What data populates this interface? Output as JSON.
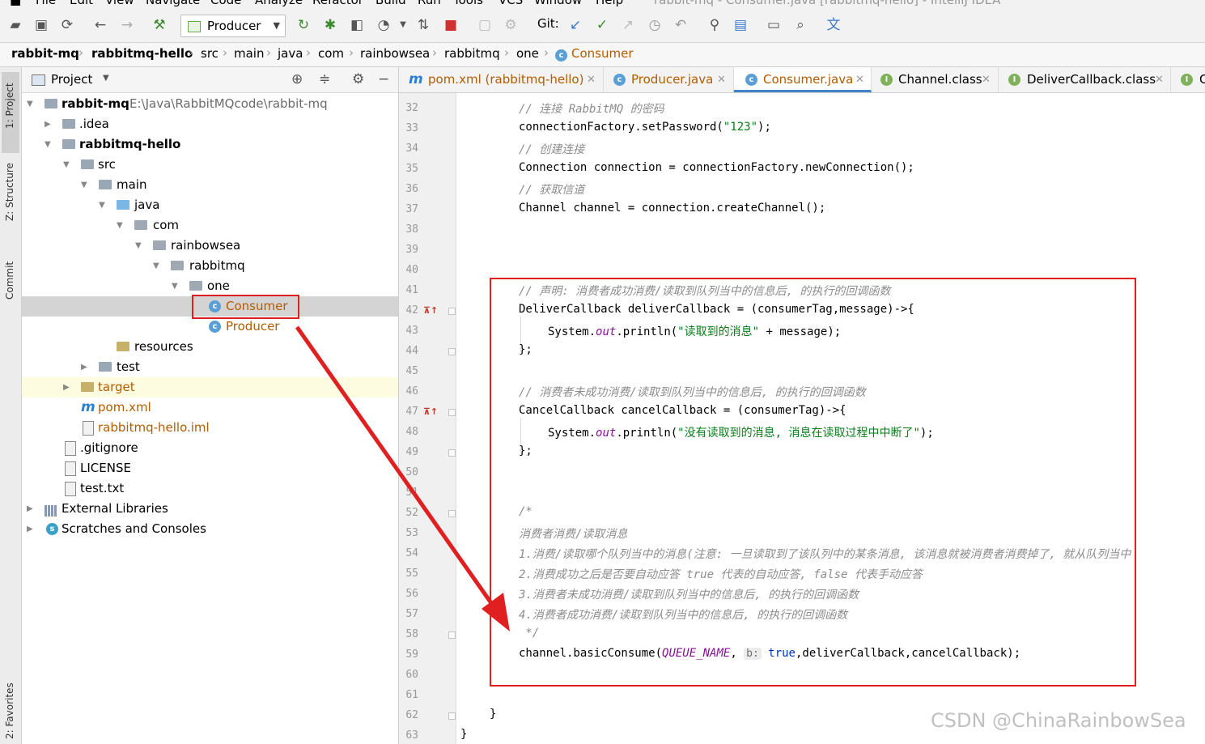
{
  "menubar": {
    "items": [
      "File",
      "Edit",
      "View",
      "Navigate",
      "Code",
      "Analyze",
      "Refactor",
      "Build",
      "Run",
      "Tools",
      "VCS",
      "Window",
      "Help"
    ],
    "window_title": "rabbit-mq - Consumer.java [rabbitmq-hello] - IntelliJ IDEA"
  },
  "toolbar": {
    "run_config": "Producer",
    "git_label": "Git:"
  },
  "breadcrumb": [
    "rabbit-mq",
    "rabbitmq-hello",
    "src",
    "main",
    "java",
    "com",
    "rainbowsea",
    "rabbitmq",
    "one",
    "Consumer"
  ],
  "left_strip": [
    "1: Project",
    "Z: Structure",
    "Commit",
    "2: Favorites"
  ],
  "project_panel": {
    "title": "Project",
    "tree": [
      {
        "label": "rabbit-mq",
        "path": "E:\\Java\\RabbitMQcode\\rabbit-mq"
      },
      {
        "label": ".idea"
      },
      {
        "label": "rabbitmq-hello"
      },
      {
        "label": "src"
      },
      {
        "label": "main"
      },
      {
        "label": "java"
      },
      {
        "label": "com"
      },
      {
        "label": "rainbowsea"
      },
      {
        "label": "rabbitmq"
      },
      {
        "label": "one"
      },
      {
        "label": "Consumer"
      },
      {
        "label": "Producer"
      },
      {
        "label": "resources"
      },
      {
        "label": "test"
      },
      {
        "label": "target"
      },
      {
        "label": "pom.xml"
      },
      {
        "label": "rabbitmq-hello.iml"
      },
      {
        "label": ".gitignore"
      },
      {
        "label": "LICENSE"
      },
      {
        "label": "test.txt"
      },
      {
        "label": "External Libraries"
      },
      {
        "label": "Scratches and Consoles"
      }
    ]
  },
  "tabs": [
    {
      "label": "pom.xml (rabbitmq-hello)"
    },
    {
      "label": "Producer.java"
    },
    {
      "label": "Consumer.java"
    },
    {
      "label": "Channel.class"
    },
    {
      "label": "DeliverCallback.class"
    },
    {
      "label": "C"
    }
  ],
  "code": {
    "line_numbers": [
      "32",
      "33",
      "34",
      "35",
      "36",
      "37",
      "38",
      "39",
      "40",
      "41",
      "42",
      "43",
      "44",
      "45",
      "46",
      "47",
      "48",
      "49",
      "50",
      "51",
      "52",
      "53",
      "54",
      "55",
      "56",
      "57",
      "58",
      "59",
      "60",
      "61",
      "62",
      "63"
    ],
    "lines": {
      "l32": "// 连接 RabbitMQ 的密码",
      "l33a": "connectionFactory.setPassword(",
      "l33s": "\"123\"",
      "l33b": ");",
      "l34": "// 创建连接",
      "l35": "Connection connection = connectionFactory.newConnection();",
      "l36": "// 获取信道",
      "l37": "Channel channel = connection.createChannel();",
      "l41": "// 声明: 消费者成功消费/读取到队列当中的信息后, 的执行的回调函数",
      "l42": "DeliverCallback deliverCallback = (consumerTag,message)->{",
      "l43a": "System.",
      "l43f": "out",
      "l43b": ".println(",
      "l43s": "\"读取到的消息\"",
      "l43c": " + message);",
      "l44": "};",
      "l46": "// 消费者未成功消费/读取到队列当中的信息后, 的执行的回调函数",
      "l47": "CancelCallback cancelCallback = (consumerTag)->{",
      "l48a": "System.",
      "l48f": "out",
      "l48b": ".println(",
      "l48s": "\"没有读取到的消息, 消息在读取过程中中断了\"",
      "l48c": ");",
      "l49": "};",
      "l52": "/*",
      "l53": "消费者消费/读取消息",
      "l54": "1.消费/读取哪个队列当中的消息(注意: 一旦读取到了该队列中的某条消息, 该消息就被消费者消费掉了, 就从队列当中",
      "l55": "2.消费成功之后是否要自动应答 true 代表的自动应答, false 代表手动应答",
      "l56": "3.消费者未成功消费/读取到队列当中的信息后, 的执行的回调函数",
      "l57": "4.消费者成功消费/读取到队列当中的信息后, 的执行的回调函数",
      "l58": " */",
      "l59a": "channel.basicConsume(",
      "l59f": "QUEUE_NAME",
      "l59h": "b:",
      "l59k": "true",
      "l59b": ",deliverCallback,cancelCallback);",
      "l62": "}",
      "l63": "}"
    }
  },
  "watermark": "CSDN @ChinaRainbowSea",
  "colors": {
    "annotation_red": "#e02020",
    "accent_blue": "#4083c9"
  }
}
